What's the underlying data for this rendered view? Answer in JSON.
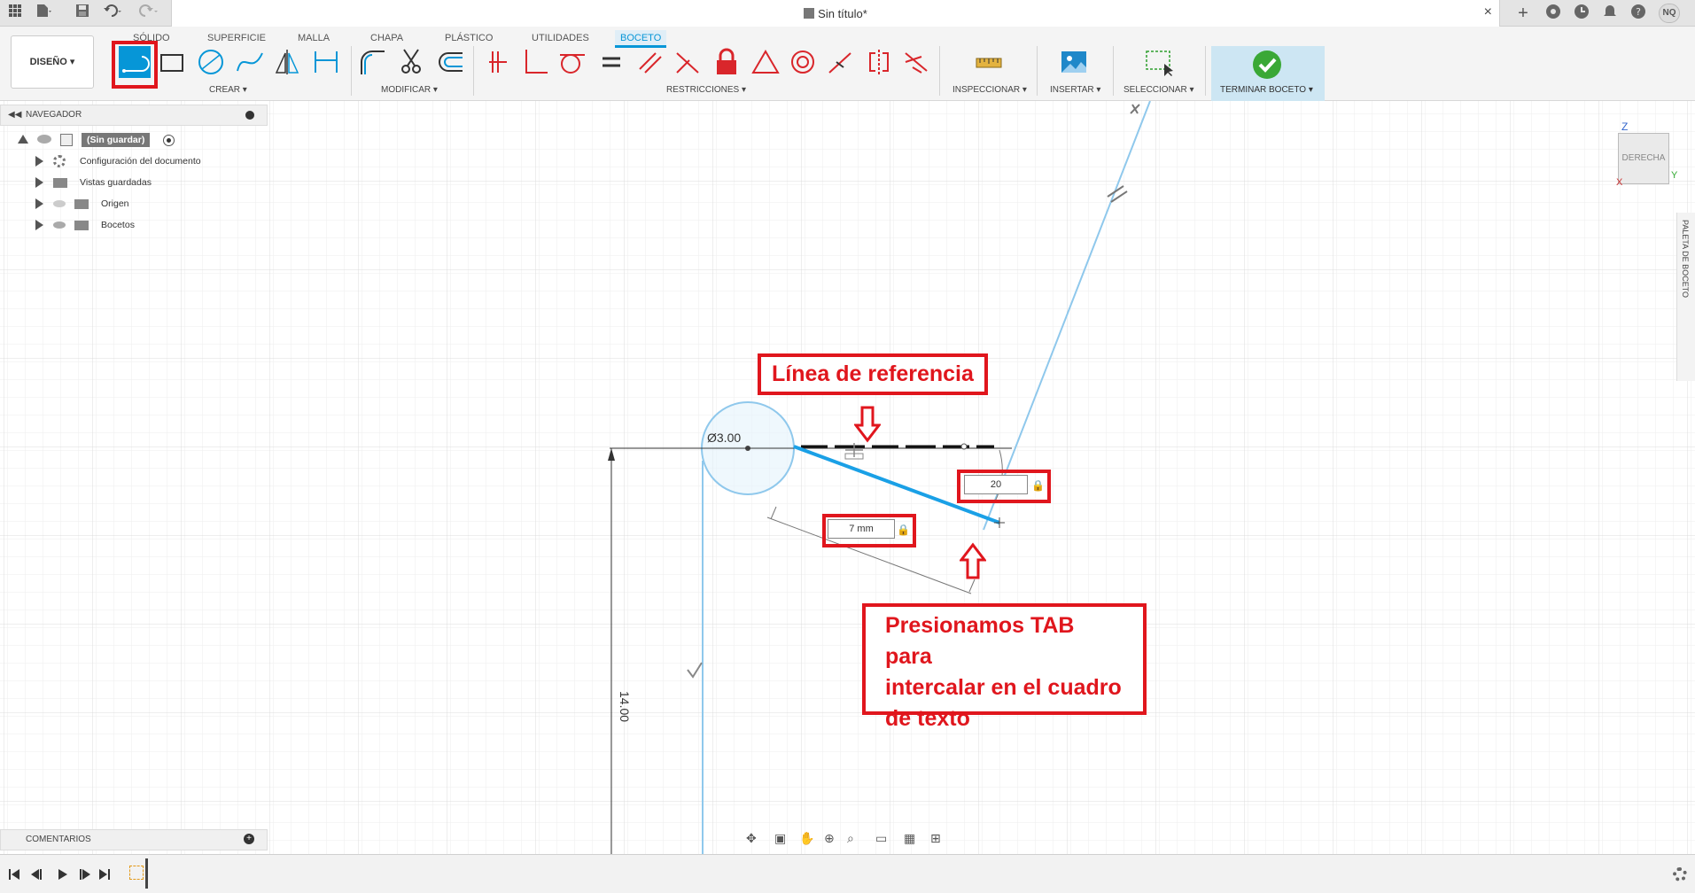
{
  "window": {
    "title": "Sin título*",
    "close_glyph": "×",
    "avatar": "NQ"
  },
  "ribbon": {
    "design_button": "DISEÑO ▾",
    "tabs": [
      {
        "label": "SÓLIDO"
      },
      {
        "label": "SUPERFICIE"
      },
      {
        "label": "MALLA"
      },
      {
        "label": "CHAPA"
      },
      {
        "label": "PLÁSTICO"
      },
      {
        "label": "UTILIDADES"
      },
      {
        "label": "BOCETO",
        "active": true
      }
    ],
    "groups": {
      "crear": "CREAR ▾",
      "modificar": "MODIFICAR ▾",
      "restricciones": "RESTRICCIONES ▾",
      "inspeccionar": "INSPECCIONAR ▾",
      "insertar": "INSERTAR ▾",
      "seleccionar": "SELECCIONAR ▾",
      "terminar": "TERMINAR BOCETO ▾"
    }
  },
  "navigator": {
    "title": "NAVEGADOR",
    "root": "(Sin guardar)",
    "items": [
      {
        "label": "Configuración del documento",
        "icon": "gear-icon"
      },
      {
        "label": "Vistas guardadas",
        "icon": "folder-icon"
      },
      {
        "label": "Origen",
        "icon": "folder-icon"
      },
      {
        "label": "Bocetos",
        "icon": "folder-icon"
      }
    ]
  },
  "comments": {
    "title": "COMENTARIOS"
  },
  "viewcube": {
    "face": "DERECHA",
    "axis_z": "Z",
    "axis_y": "Y",
    "axis_x": "X"
  },
  "side_palette": {
    "label": "PALETA DE BOCETO"
  },
  "sketch": {
    "diameter_label": "Ø3.00",
    "vertical_dim": "14.00",
    "angle_input": "20",
    "length_input": "7 mm"
  },
  "annotations": {
    "reference": "Línea de referencia",
    "tab_hint": [
      "Presionamos TAB para",
      "intercalar en el cuadro",
      "de texto"
    ]
  },
  "colors": {
    "accent": "#0696d7",
    "annotation_red": "#e0161d",
    "sketch_line": "#29a3e0"
  }
}
